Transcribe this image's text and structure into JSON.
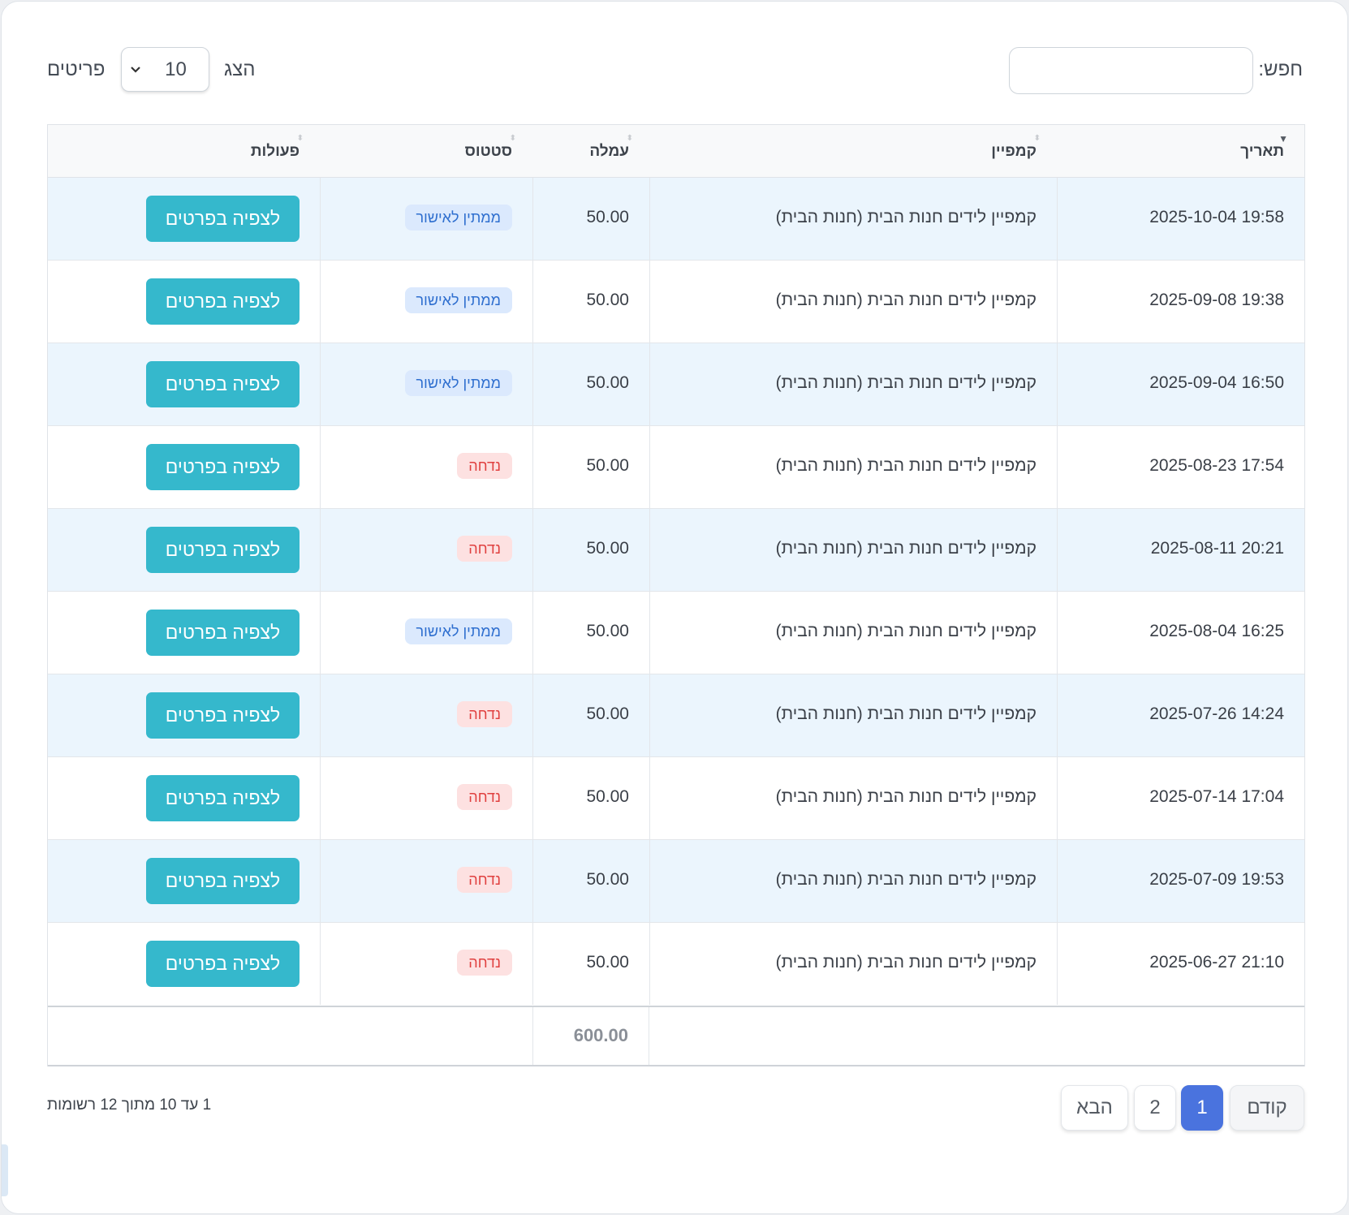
{
  "search": {
    "label": "חפש:",
    "value": "",
    "placeholder": ""
  },
  "length": {
    "show_label": "הצג",
    "selected": "10",
    "items_label": "פריטים"
  },
  "columns": {
    "date": "תאריך",
    "campaign": "קמפיין",
    "amount": "עמלה",
    "status": "סטטוס",
    "actions": "פעולות"
  },
  "rows": [
    {
      "date": "2025-10-04 19:58",
      "campaign": "קמפיין לידים חנות הבית (חנות הבית)",
      "amount": "50.00",
      "status": "ממתין לאישור",
      "status_type": "pending",
      "action": "לצפיה בפרטים"
    },
    {
      "date": "2025-09-08 19:38",
      "campaign": "קמפיין לידים חנות הבית (חנות הבית)",
      "amount": "50.00",
      "status": "ממתין לאישור",
      "status_type": "pending",
      "action": "לצפיה בפרטים"
    },
    {
      "date": "2025-09-04 16:50",
      "campaign": "קמפיין לידים חנות הבית (חנות הבית)",
      "amount": "50.00",
      "status": "ממתין לאישור",
      "status_type": "pending",
      "action": "לצפיה בפרטים"
    },
    {
      "date": "2025-08-23 17:54",
      "campaign": "קמפיין לידים חנות הבית (חנות הבית)",
      "amount": "50.00",
      "status": "נדחה",
      "status_type": "rejected",
      "action": "לצפיה בפרטים"
    },
    {
      "date": "2025-08-11 20:21",
      "campaign": "קמפיין לידים חנות הבית (חנות הבית)",
      "amount": "50.00",
      "status": "נדחה",
      "status_type": "rejected",
      "action": "לצפיה בפרטים"
    },
    {
      "date": "2025-08-04 16:25",
      "campaign": "קמפיין לידים חנות הבית (חנות הבית)",
      "amount": "50.00",
      "status": "ממתין לאישור",
      "status_type": "pending",
      "action": "לצפיה בפרטים"
    },
    {
      "date": "2025-07-26 14:24",
      "campaign": "קמפיין לידים חנות הבית (חנות הבית)",
      "amount": "50.00",
      "status": "נדחה",
      "status_type": "rejected",
      "action": "לצפיה בפרטים"
    },
    {
      "date": "2025-07-14 17:04",
      "campaign": "קמפיין לידים חנות הבית (חנות הבית)",
      "amount": "50.00",
      "status": "נדחה",
      "status_type": "rejected",
      "action": "לצפיה בפרטים"
    },
    {
      "date": "2025-07-09 19:53",
      "campaign": "קמפיין לידים חנות הבית (חנות הבית)",
      "amount": "50.00",
      "status": "נדחה",
      "status_type": "rejected",
      "action": "לצפיה בפרטים"
    },
    {
      "date": "2025-06-27 21:10",
      "campaign": "קמפיין לידים חנות הבית (חנות הבית)",
      "amount": "50.00",
      "status": "נדחה",
      "status_type": "rejected",
      "action": "לצפיה בפרטים"
    }
  ],
  "footer": {
    "total": "600.00"
  },
  "info": "1 עד 10 מתוך 12 רשומות",
  "pagination": {
    "prev": "קודם",
    "pages": [
      "1",
      "2"
    ],
    "active_page": "1",
    "next": "הבא"
  },
  "colors": {
    "button": "#35b8cc",
    "pending_bg": "#dbe9fd",
    "pending_text": "#2f6fcf",
    "rejected_bg": "#fde1e1",
    "rejected_text": "#e0403f",
    "active_page": "#4a73de",
    "row_stripe": "#ebf5fd"
  },
  "icons": {
    "sort_active": "sort-desc-icon",
    "sort": "sort-both-icon",
    "select": "chevron-down-icon"
  }
}
